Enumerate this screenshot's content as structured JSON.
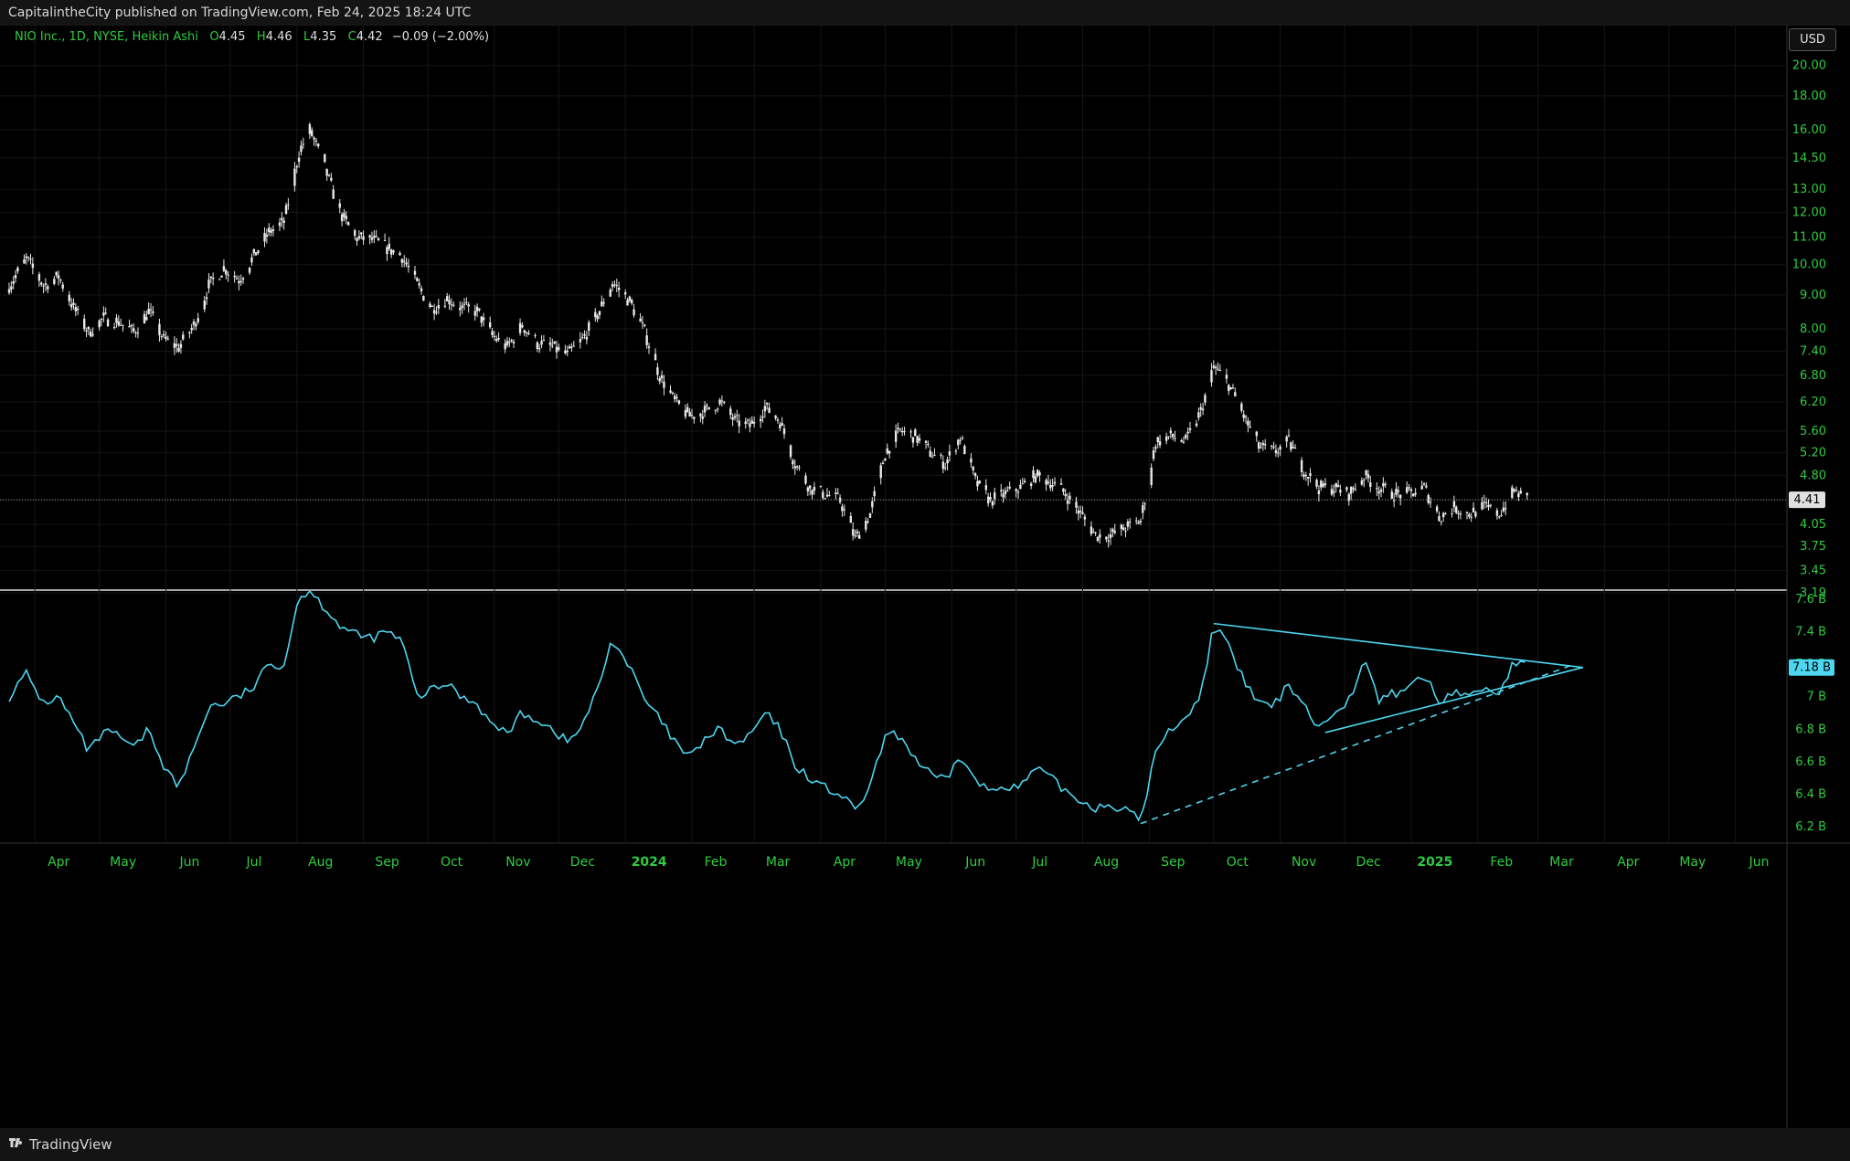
{
  "header": {
    "published": "CapitalintheCity published on TradingView.com, Feb 24, 2025 18:24 UTC"
  },
  "footer": {
    "brand": "TradingView"
  },
  "legend": {
    "symbol": "NIO Inc., 1D, NYSE, Heikin Ashi",
    "o_label": "O",
    "o_value": "4.45",
    "h_label": "H",
    "h_value": "4.46",
    "l_label": "L",
    "l_value": "4.35",
    "c_label": "C",
    "c_value": "4.42",
    "change": "−0.09 (−2.00%)"
  },
  "currency": "USD",
  "colors": {
    "bg": "#000000",
    "candle": "#e8e8e8",
    "line": "#4dd6f0",
    "axis_text": "#2ecc40",
    "panel_bg": "#141414"
  },
  "chart_data": [
    {
      "type": "candlestick",
      "scale": "log",
      "ylim": [
        3.19,
        21.5
      ],
      "yticks": [
        "20.00",
        "18.00",
        "16.00",
        "14.50",
        "13.00",
        "12.00",
        "11.00",
        "10.00",
        "9.00",
        "8.00",
        "7.40",
        "6.80",
        "6.20",
        "5.60",
        "5.20",
        "4.80",
        "4.41",
        "4.05",
        "3.75",
        "3.45",
        "3.19"
      ],
      "last_price": "4.41",
      "last_price_value": 4.41,
      "x_start": "2023-03-20",
      "x_end": "2025-06-25",
      "xticks": [
        {
          "label": "Apr",
          "date": "2023-04-01"
        },
        {
          "label": "May",
          "date": "2023-05-01"
        },
        {
          "label": "Jun",
          "date": "2023-06-01"
        },
        {
          "label": "Jul",
          "date": "2023-07-01"
        },
        {
          "label": "Aug",
          "date": "2023-08-01"
        },
        {
          "label": "Sep",
          "date": "2023-09-01"
        },
        {
          "label": "Oct",
          "date": "2023-10-01"
        },
        {
          "label": "Nov",
          "date": "2023-11-01"
        },
        {
          "label": "Dec",
          "date": "2023-12-01"
        },
        {
          "label": "2024",
          "date": "2024-01-01",
          "bold": true
        },
        {
          "label": "Feb",
          "date": "2024-02-01"
        },
        {
          "label": "Mar",
          "date": "2024-03-01"
        },
        {
          "label": "Apr",
          "date": "2024-04-01"
        },
        {
          "label": "May",
          "date": "2024-05-01"
        },
        {
          "label": "Jun",
          "date": "2024-06-01"
        },
        {
          "label": "Jul",
          "date": "2024-07-01"
        },
        {
          "label": "Aug",
          "date": "2024-08-01"
        },
        {
          "label": "Sep",
          "date": "2024-09-01"
        },
        {
          "label": "Oct",
          "date": "2024-10-01"
        },
        {
          "label": "Nov",
          "date": "2024-11-01"
        },
        {
          "label": "Dec",
          "date": "2024-12-01"
        },
        {
          "label": "2025",
          "date": "2025-01-01",
          "bold": true
        },
        {
          "label": "Feb",
          "date": "2025-02-01"
        },
        {
          "label": "Mar",
          "date": "2025-03-01"
        },
        {
          "label": "Apr",
          "date": "2025-04-01"
        },
        {
          "label": "May",
          "date": "2025-05-01"
        },
        {
          "label": "Jun",
          "date": "2025-06-01"
        }
      ],
      "close_path": [
        [
          "2023-03-20",
          9.3
        ],
        [
          "2023-03-28",
          10.2
        ],
        [
          "2023-04-05",
          9.3
        ],
        [
          "2023-04-12",
          9.6
        ],
        [
          "2023-04-19",
          8.6
        ],
        [
          "2023-04-26",
          7.9
        ],
        [
          "2023-05-03",
          8.3
        ],
        [
          "2023-05-10",
          8.2
        ],
        [
          "2023-05-17",
          7.9
        ],
        [
          "2023-05-24",
          8.5
        ],
        [
          "2023-05-31",
          7.7
        ],
        [
          "2023-06-07",
          7.5
        ],
        [
          "2023-06-14",
          8.1
        ],
        [
          "2023-06-21",
          9.3
        ],
        [
          "2023-06-28",
          9.9
        ],
        [
          "2023-07-05",
          9.5
        ],
        [
          "2023-07-12",
          10.3
        ],
        [
          "2023-07-19",
          11.2
        ],
        [
          "2023-07-26",
          11.6
        ],
        [
          "2023-08-02",
          14.8
        ],
        [
          "2023-08-07",
          16.0
        ],
        [
          "2023-08-14",
          14.0
        ],
        [
          "2023-08-21",
          12.0
        ],
        [
          "2023-08-28",
          11.0
        ],
        [
          "2023-09-05",
          10.9
        ],
        [
          "2023-09-12",
          10.6
        ],
        [
          "2023-09-19",
          10.3
        ],
        [
          "2023-09-26",
          9.3
        ],
        [
          "2023-10-03",
          8.6
        ],
        [
          "2023-10-10",
          8.9
        ],
        [
          "2023-10-17",
          8.6
        ],
        [
          "2023-10-24",
          8.5
        ],
        [
          "2023-10-31",
          7.8
        ],
        [
          "2023-11-07",
          7.5
        ],
        [
          "2023-11-14",
          8.1
        ],
        [
          "2023-11-21",
          7.6
        ],
        [
          "2023-11-28",
          7.5
        ],
        [
          "2023-12-05",
          7.3
        ],
        [
          "2023-12-12",
          7.7
        ],
        [
          "2023-12-19",
          8.4
        ],
        [
          "2023-12-26",
          9.4
        ],
        [
          "2024-01-03",
          8.8
        ],
        [
          "2024-01-10",
          7.9
        ],
        [
          "2024-01-17",
          6.8
        ],
        [
          "2024-01-24",
          6.2
        ],
        [
          "2024-01-31",
          5.9
        ],
        [
          "2024-02-07",
          6.0
        ],
        [
          "2024-02-14",
          6.2
        ],
        [
          "2024-02-21",
          5.8
        ],
        [
          "2024-02-28",
          5.7
        ],
        [
          "2024-03-06",
          6.1
        ],
        [
          "2024-03-13",
          5.8
        ],
        [
          "2024-03-20",
          5.0
        ],
        [
          "2024-03-27",
          4.6
        ],
        [
          "2024-04-03",
          4.5
        ],
        [
          "2024-04-10",
          4.4
        ],
        [
          "2024-04-17",
          3.85
        ],
        [
          "2024-04-24",
          4.2
        ],
        [
          "2024-05-01",
          5.2
        ],
        [
          "2024-05-08",
          5.6
        ],
        [
          "2024-05-15",
          5.5
        ],
        [
          "2024-05-22",
          5.2
        ],
        [
          "2024-05-29",
          5.0
        ],
        [
          "2024-06-05",
          5.5
        ],
        [
          "2024-06-12",
          4.7
        ],
        [
          "2024-06-19",
          4.4
        ],
        [
          "2024-06-26",
          4.5
        ],
        [
          "2024-07-03",
          4.6
        ],
        [
          "2024-07-10",
          4.8
        ],
        [
          "2024-07-17",
          4.7
        ],
        [
          "2024-07-24",
          4.5
        ],
        [
          "2024-07-31",
          4.2
        ],
        [
          "2024-08-07",
          3.9
        ],
        [
          "2024-08-14",
          3.9
        ],
        [
          "2024-08-21",
          4.0
        ],
        [
          "2024-08-28",
          4.1
        ],
        [
          "2024-09-04",
          5.4
        ],
        [
          "2024-09-11",
          5.5
        ],
        [
          "2024-09-18",
          5.4
        ],
        [
          "2024-09-25",
          6.0
        ],
        [
          "2024-10-01",
          7.0
        ],
        [
          "2024-10-08",
          6.6
        ],
        [
          "2024-10-15",
          5.9
        ],
        [
          "2024-10-22",
          5.3
        ],
        [
          "2024-10-29",
          5.2
        ],
        [
          "2024-11-05",
          5.4
        ],
        [
          "2024-11-12",
          4.9
        ],
        [
          "2024-11-19",
          4.6
        ],
        [
          "2024-11-26",
          4.6
        ],
        [
          "2024-12-03",
          4.5
        ],
        [
          "2024-12-10",
          4.8
        ],
        [
          "2024-12-17",
          4.6
        ],
        [
          "2024-12-24",
          4.5
        ],
        [
          "2024-12-31",
          4.5
        ],
        [
          "2025-01-07",
          4.6
        ],
        [
          "2025-01-14",
          4.15
        ],
        [
          "2025-01-21",
          4.3
        ],
        [
          "2025-01-28",
          4.2
        ],
        [
          "2025-02-04",
          4.3
        ],
        [
          "2025-02-11",
          4.2
        ],
        [
          "2025-02-18",
          4.55
        ],
        [
          "2025-02-24",
          4.42
        ]
      ]
    },
    {
      "type": "line",
      "ylim": [
        6.1,
        7.65
      ],
      "yticks": [
        "7.6 B",
        "7.4 B",
        "7.2 B",
        "7 B",
        "6.8 B",
        "6.6 B",
        "6.4 B",
        "6.2 B"
      ],
      "last_value": "7.18 B",
      "last_value_num": 7.18,
      "points": [
        [
          "2023-03-20",
          7.0
        ],
        [
          "2023-03-28",
          7.14
        ],
        [
          "2023-04-05",
          6.96
        ],
        [
          "2023-04-12",
          7.0
        ],
        [
          "2023-04-19",
          6.84
        ],
        [
          "2023-04-26",
          6.66
        ],
        [
          "2023-05-03",
          6.78
        ],
        [
          "2023-05-10",
          6.76
        ],
        [
          "2023-05-17",
          6.68
        ],
        [
          "2023-05-24",
          6.8
        ],
        [
          "2023-05-31",
          6.58
        ],
        [
          "2023-06-07",
          6.44
        ],
        [
          "2023-06-14",
          6.68
        ],
        [
          "2023-06-21",
          6.94
        ],
        [
          "2023-06-28",
          6.96
        ],
        [
          "2023-07-05",
          7.0
        ],
        [
          "2023-07-12",
          7.06
        ],
        [
          "2023-07-19",
          7.2
        ],
        [
          "2023-07-26",
          7.2
        ],
        [
          "2023-08-02",
          7.62
        ],
        [
          "2023-08-07",
          7.65
        ],
        [
          "2023-08-14",
          7.55
        ],
        [
          "2023-08-21",
          7.44
        ],
        [
          "2023-08-28",
          7.38
        ],
        [
          "2023-09-05",
          7.36
        ],
        [
          "2023-09-12",
          7.4
        ],
        [
          "2023-09-19",
          7.34
        ],
        [
          "2023-09-26",
          7.0
        ],
        [
          "2023-10-03",
          7.04
        ],
        [
          "2023-10-10",
          7.08
        ],
        [
          "2023-10-17",
          7.0
        ],
        [
          "2023-10-24",
          6.96
        ],
        [
          "2023-10-31",
          6.82
        ],
        [
          "2023-11-07",
          6.78
        ],
        [
          "2023-11-14",
          6.9
        ],
        [
          "2023-11-21",
          6.86
        ],
        [
          "2023-11-28",
          6.8
        ],
        [
          "2023-12-05",
          6.72
        ],
        [
          "2023-12-12",
          6.82
        ],
        [
          "2023-12-19",
          7.04
        ],
        [
          "2023-12-26",
          7.36
        ],
        [
          "2024-01-03",
          7.18
        ],
        [
          "2024-01-10",
          6.98
        ],
        [
          "2024-01-17",
          6.86
        ],
        [
          "2024-01-24",
          6.72
        ],
        [
          "2024-01-31",
          6.62
        ],
        [
          "2024-02-07",
          6.74
        ],
        [
          "2024-02-14",
          6.8
        ],
        [
          "2024-02-21",
          6.7
        ],
        [
          "2024-02-28",
          6.76
        ],
        [
          "2024-03-06",
          6.9
        ],
        [
          "2024-03-13",
          6.8
        ],
        [
          "2024-03-20",
          6.58
        ],
        [
          "2024-03-27",
          6.5
        ],
        [
          "2024-04-03",
          6.44
        ],
        [
          "2024-04-10",
          6.4
        ],
        [
          "2024-04-17",
          6.3
        ],
        [
          "2024-04-24",
          6.44
        ],
        [
          "2024-05-01",
          6.76
        ],
        [
          "2024-05-08",
          6.76
        ],
        [
          "2024-05-15",
          6.62
        ],
        [
          "2024-05-22",
          6.52
        ],
        [
          "2024-05-29",
          6.48
        ],
        [
          "2024-06-05",
          6.64
        ],
        [
          "2024-06-12",
          6.48
        ],
        [
          "2024-06-19",
          6.42
        ],
        [
          "2024-06-26",
          6.46
        ],
        [
          "2024-07-03",
          6.44
        ],
        [
          "2024-07-10",
          6.56
        ],
        [
          "2024-07-17",
          6.5
        ],
        [
          "2024-07-24",
          6.42
        ],
        [
          "2024-07-31",
          6.36
        ],
        [
          "2024-08-07",
          6.32
        ],
        [
          "2024-08-14",
          6.34
        ],
        [
          "2024-08-21",
          6.3
        ],
        [
          "2024-08-28",
          6.24
        ],
        [
          "2024-09-04",
          6.66
        ],
        [
          "2024-09-11",
          6.8
        ],
        [
          "2024-09-18",
          6.88
        ],
        [
          "2024-09-25",
          7.0
        ],
        [
          "2024-10-01",
          7.45
        ],
        [
          "2024-10-08",
          7.3
        ],
        [
          "2024-10-15",
          7.1
        ],
        [
          "2024-10-22",
          6.96
        ],
        [
          "2024-10-29",
          6.94
        ],
        [
          "2024-11-05",
          7.08
        ],
        [
          "2024-11-12",
          6.96
        ],
        [
          "2024-11-19",
          6.8
        ],
        [
          "2024-11-26",
          6.92
        ],
        [
          "2024-12-03",
          6.98
        ],
        [
          "2024-12-10",
          7.22
        ],
        [
          "2024-12-17",
          6.98
        ],
        [
          "2024-12-24",
          7.02
        ],
        [
          "2024-12-31",
          7.06
        ],
        [
          "2025-01-07",
          7.14
        ],
        [
          "2025-01-14",
          6.96
        ],
        [
          "2025-01-21",
          7.04
        ],
        [
          "2025-01-28",
          7.0
        ],
        [
          "2025-02-04",
          7.06
        ],
        [
          "2025-02-11",
          7.02
        ],
        [
          "2025-02-18",
          7.22
        ],
        [
          "2025-02-24",
          7.18
        ]
      ],
      "trendlines": [
        {
          "from": [
            "2024-10-01",
            7.45
          ],
          "to": [
            "2025-03-22",
            7.18
          ],
          "style": "solid"
        },
        {
          "from": [
            "2024-11-22",
            6.78
          ],
          "to": [
            "2025-03-22",
            7.18
          ],
          "style": "solid"
        },
        {
          "from": [
            "2024-08-28",
            6.22
          ],
          "to": [
            "2025-03-18",
            7.2
          ],
          "style": "dashed"
        }
      ]
    }
  ]
}
